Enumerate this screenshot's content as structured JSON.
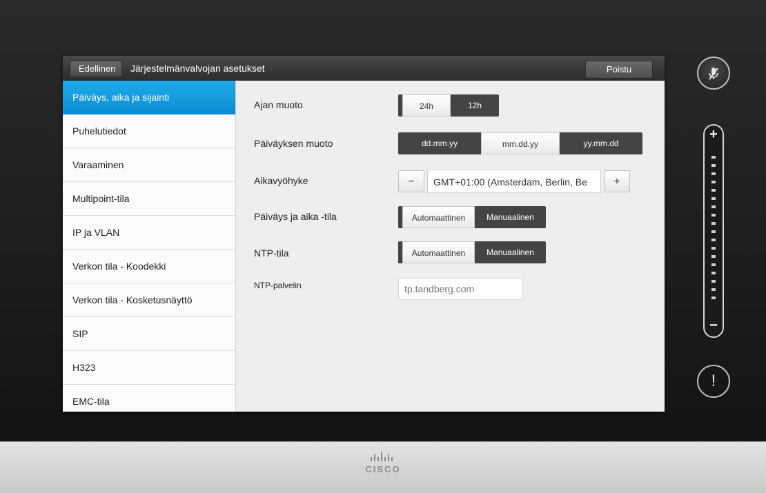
{
  "header": {
    "back_label": "Edellinen",
    "title": "Järjestelmänvalvojan asetukset",
    "exit_label": "Poistu"
  },
  "sidebar": {
    "items": [
      {
        "label": "Päiväys, aika ja sijainti",
        "active": true
      },
      {
        "label": "Puhelutiedot",
        "active": false
      },
      {
        "label": "Varaaminen",
        "active": false
      },
      {
        "label": "Multipoint-tila",
        "active": false
      },
      {
        "label": "IP ja VLAN",
        "active": false
      },
      {
        "label": "Verkon tila - Koodekki",
        "active": false
      },
      {
        "label": "Verkon tila - Kosketusnäyttö",
        "active": false
      },
      {
        "label": "SIP",
        "active": false
      },
      {
        "label": "H323",
        "active": false
      },
      {
        "label": "EMC-tila",
        "active": false
      }
    ]
  },
  "settings": {
    "time_format": {
      "label": "Ajan muoto",
      "options": [
        "24h",
        "12h"
      ],
      "selected": "24h"
    },
    "date_format": {
      "label": "Päiväyksen muoto",
      "options": [
        "dd.mm.yy",
        "mm.dd.yy",
        "yy.mm.dd"
      ],
      "selected": "mm.dd.yy"
    },
    "timezone": {
      "label": "Aikavyöhyke",
      "value": "GMT+01:00 (Amsterdam, Berlin, Be",
      "minus": "−",
      "plus": "+"
    },
    "date_time_mode": {
      "label": "Päiväys ja aika -tila",
      "options": [
        "Automaattinen",
        "Manuaalinen"
      ],
      "selected": "Automaattinen"
    },
    "ntp_mode": {
      "label": "NTP-tila",
      "options": [
        "Automaattinen",
        "Manuaalinen"
      ],
      "selected": "Automaattinen"
    },
    "ntp_server": {
      "label": "NTP-palvelin",
      "placeholder": "tp.tandberg.com"
    }
  },
  "rail": {
    "volume_plus": "+",
    "volume_minus": "−",
    "alert_symbol": "!"
  },
  "brand": {
    "name": "CISCO"
  },
  "colors": {
    "accent": "#0a8ed3",
    "dark_button": "#444444"
  },
  "icons": [
    "microphone-muted-icon",
    "volume-plus-icon",
    "volume-minus-icon",
    "alert-icon",
    "cisco-logo"
  ]
}
